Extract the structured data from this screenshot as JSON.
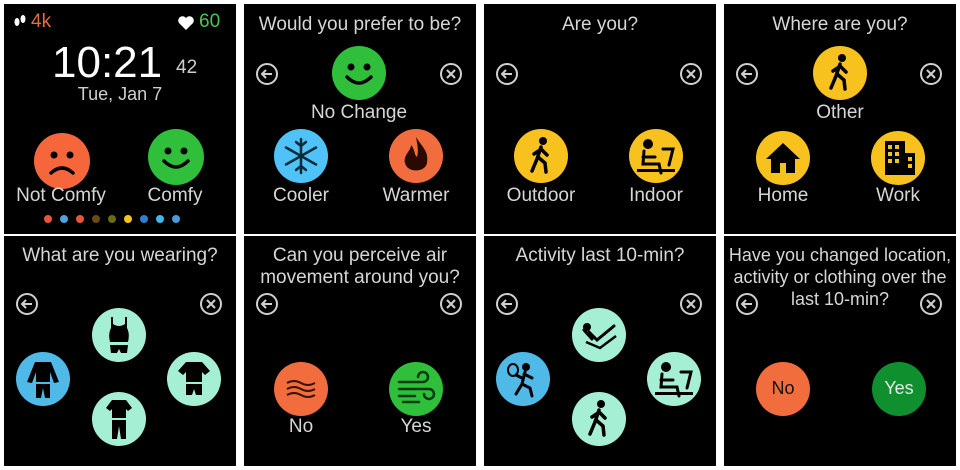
{
  "home": {
    "steps": "4k",
    "heart_rate": "60",
    "time": "10:21",
    "seconds": "42",
    "date": "Tue, Jan 7",
    "not_comfy_label": "Not Comfy",
    "comfy_label": "Comfy",
    "page_dots": [
      "#e8553a",
      "#4fa3e0",
      "#e8553a",
      "#6b4a16",
      "#6b6b10",
      "#f5c51a",
      "#2e7fd0",
      "#3fb8e8",
      "#4a9ad8"
    ]
  },
  "prefer": {
    "title": "Would you prefer to be?",
    "no_change_label": "No Change",
    "cooler_label": "Cooler",
    "warmer_label": "Warmer"
  },
  "are_you": {
    "title": "Are you?",
    "outdoor_label": "Outdoor",
    "indoor_label": "Indoor"
  },
  "where": {
    "title": "Where are you?",
    "other_label": "Other",
    "home_label": "Home",
    "work_label": "Work"
  },
  "wearing": {
    "title": "What are you wearing?"
  },
  "air": {
    "title_line1": "Can you perceive air",
    "title_line2": "movement around you?",
    "no_label": "No",
    "yes_label": "Yes"
  },
  "activity": {
    "title": "Activity last 10-min?"
  },
  "changed": {
    "title_line1": "Have you changed location,",
    "title_line2": "activity or clothing over the",
    "title_line3": "last 10-min?",
    "no_label": "No",
    "yes_label": "Yes"
  },
  "colors": {
    "comfy_green": "#2fbf3a",
    "not_comfy_orange": "#f5673a",
    "cool_blue": "#4fc3f7",
    "warm_orange": "#f26d3d",
    "location_yellow": "#f7c21d",
    "clothing_teal": "#a5f0d4",
    "clothing_blue": "#4fb9e8",
    "yes_green": "#0f8f2d"
  }
}
